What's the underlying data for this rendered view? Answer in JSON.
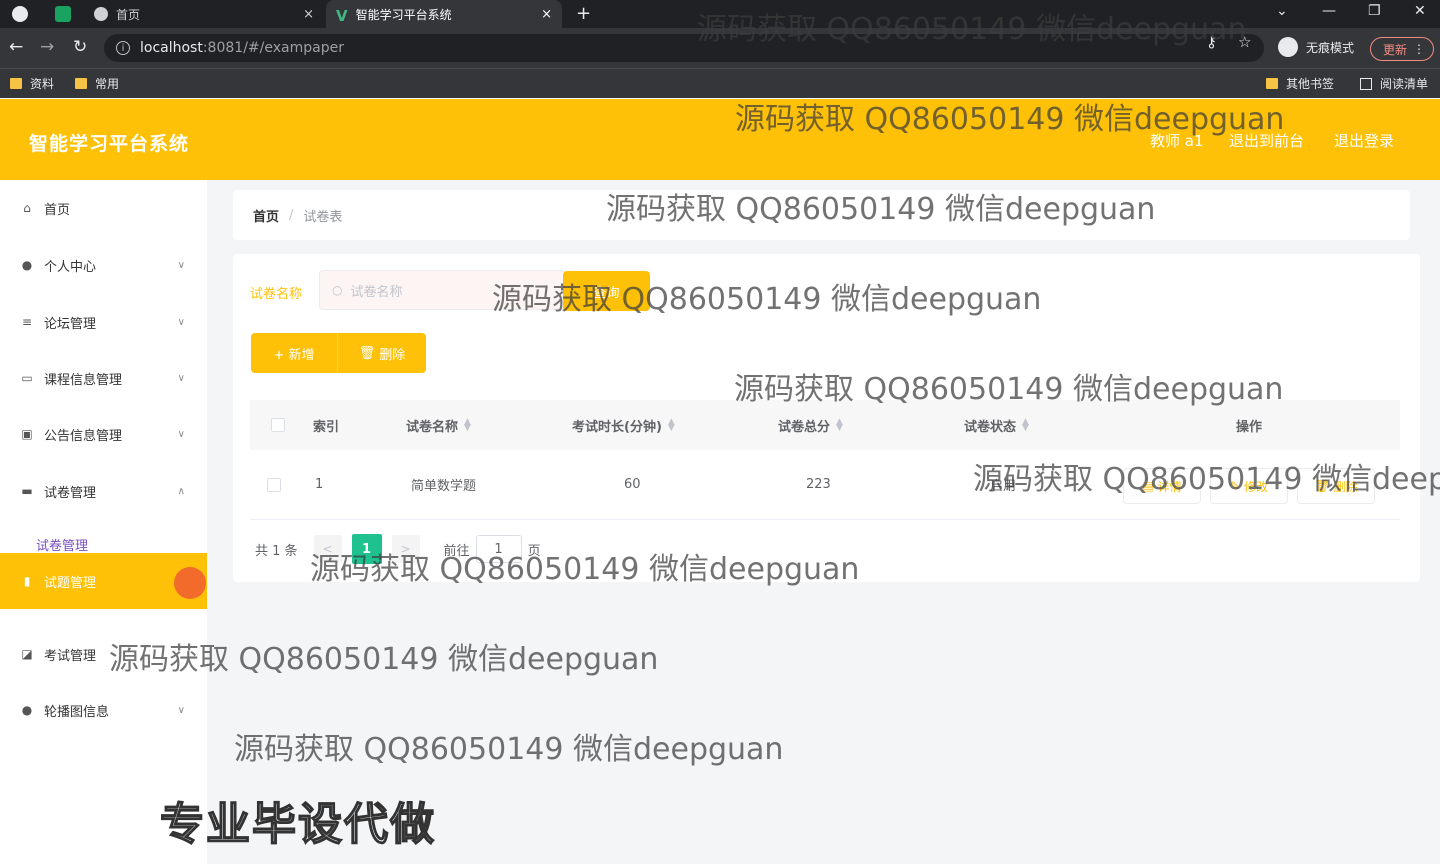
{
  "browser": {
    "tabs": [
      {
        "label": "首页",
        "close": "×"
      },
      {
        "label": "智能学习平台系统",
        "close": "×"
      }
    ],
    "new_tab": "+",
    "window_controls": [
      "⌄",
      "—",
      "❐",
      "✕"
    ],
    "nav": {
      "back": "←",
      "forward": "→",
      "reload": "↻"
    },
    "address_host": "localhost",
    "address_path": ":8081/#/exampaper",
    "incognito_label": "无痕模式",
    "update_label": "更新",
    "bookmarks": [
      {
        "label": "资料",
        "icon": "folder-icon"
      },
      {
        "label": "常用",
        "icon": "folder-icon"
      }
    ],
    "bookmarks_right": [
      {
        "label": "其他书签",
        "icon": "folder-icon"
      },
      {
        "label": "阅读清单",
        "icon": "reading-list-icon"
      }
    ]
  },
  "header": {
    "title": "智能学习平台系统",
    "user": "教师 a1",
    "to_front": "退出到前台",
    "logout": "退出登录",
    "color": "#ffc107"
  },
  "sidebar": {
    "items": [
      {
        "label": "首页",
        "icon": "home-icon",
        "chevron": false
      },
      {
        "label": "个人中心",
        "icon": "user-icon",
        "chevron": true
      },
      {
        "label": "论坛管理",
        "icon": "sliders-icon",
        "chevron": true
      },
      {
        "label": "课程信息管理",
        "icon": "card-icon",
        "chevron": true
      },
      {
        "label": "公告信息管理",
        "icon": "clipboard-icon",
        "chevron": true
      },
      {
        "label": "试卷管理",
        "icon": "laptop-icon",
        "chevron": true
      },
      {
        "label": "试题管理",
        "icon": "bar-chart-icon",
        "chevron": false
      },
      {
        "label": "考试管理",
        "icon": "chart-icon",
        "chevron": false
      },
      {
        "label": "轮播图信息",
        "icon": "user-icon",
        "chevron": true
      }
    ],
    "sub_item": "试卷管理"
  },
  "breadcrumb": {
    "home": "首页",
    "separator": "/",
    "current": "试卷表"
  },
  "search": {
    "label": "试卷名称",
    "placeholder": "试卷名称",
    "button": "查询"
  },
  "actions": {
    "add": "+ 新增",
    "delete": "删除"
  },
  "table": {
    "columns": [
      "索引",
      "试卷名称",
      "考试时长(分钟)",
      "试卷总分",
      "试卷状态",
      "操作"
    ],
    "rows": [
      {
        "index": "1",
        "name": "简单数学题",
        "duration": "60",
        "total": "223",
        "status": "启用"
      }
    ],
    "row_actions": {
      "detail": "详情",
      "edit": "修改",
      "delete": "删除"
    }
  },
  "pagination": {
    "total": "共 1 条",
    "prev": "<",
    "page": "1",
    "next": ">",
    "goto": "前往",
    "goto_value": "1",
    "page_suffix": "页"
  },
  "overlay": {
    "watermark": "源码获取 QQ86050149 微信deepguan",
    "promo": "专业毕设代做"
  }
}
